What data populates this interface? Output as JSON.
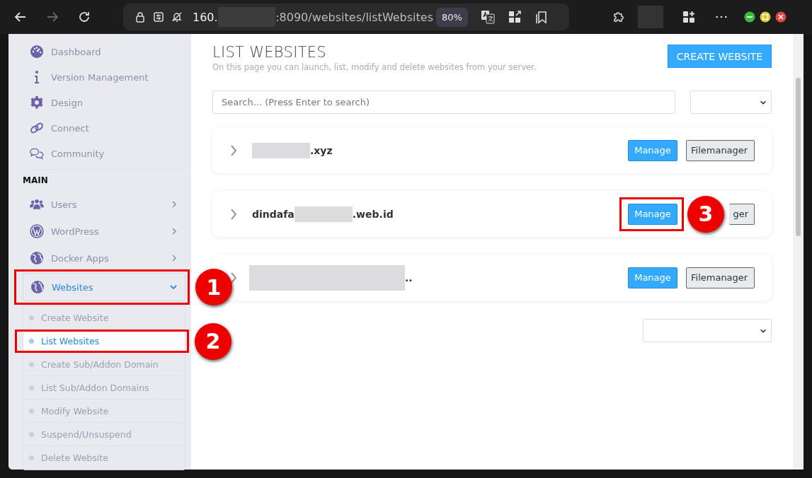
{
  "browser": {
    "address_parts": [
      {
        "kind": "text",
        "text": "160."
      },
      {
        "kind": "redacted"
      },
      {
        "kind": "text",
        "text": ":8090/websites/listWebsites"
      }
    ],
    "zoom": "80%"
  },
  "sidebar": {
    "top_items": [
      {
        "label": "Dashboard"
      },
      {
        "label": "Version Management"
      },
      {
        "label": "Design"
      },
      {
        "label": "Connect"
      },
      {
        "label": "Community"
      }
    ],
    "section_heading": "MAIN",
    "main_items": [
      {
        "label": "Users",
        "expanded": false
      },
      {
        "label": "WordPress",
        "expanded": false
      },
      {
        "label": "Docker Apps",
        "expanded": false
      },
      {
        "label": "Websites",
        "expanded": true,
        "annotation": "1"
      }
    ],
    "submenu": [
      {
        "label": "Create Website",
        "selected": false
      },
      {
        "label": "List Websites",
        "selected": true,
        "annotation": "2"
      },
      {
        "label": "Create Sub/Addon Domain",
        "selected": false
      },
      {
        "label": "List Sub/Addon Domains",
        "selected": false
      },
      {
        "label": "Modify Website",
        "selected": false
      },
      {
        "label": "Suspend/Unsuspend",
        "selected": false
      },
      {
        "label": "Delete Website",
        "selected": false
      }
    ]
  },
  "page": {
    "title": "LIST WEBSITES",
    "subtitle": "On this page you can launch, list, modify and delete websites from your server.",
    "create_button": "CREATE WEBSITE",
    "search": {
      "placeholder": "Search... (Press Enter to search)"
    },
    "websites": [
      {
        "domain_parts": [
          {
            "kind": "redacted"
          },
          {
            "kind": "text",
            "text": ".xyz"
          }
        ],
        "buttons": [
          {
            "label": "Manage",
            "kind": "primary"
          },
          {
            "label": "Filemanager",
            "kind": "secondary"
          }
        ]
      },
      {
        "domain_parts": [
          {
            "kind": "text",
            "text": "dindafa"
          },
          {
            "kind": "redacted"
          },
          {
            "kind": "text",
            "text": ".web.id"
          }
        ],
        "buttons": [
          {
            "label": "Manage",
            "kind": "primary",
            "annotation": "3"
          },
          {
            "label": "ger",
            "kind": "secondary"
          }
        ]
      },
      {
        "domain_parts": [
          {
            "kind": "redacted_long"
          },
          {
            "kind": "text",
            "text": ".."
          }
        ],
        "buttons": [
          {
            "label": "Manage",
            "kind": "primary"
          },
          {
            "label": "Filemanager",
            "kind": "secondary"
          }
        ]
      }
    ]
  }
}
